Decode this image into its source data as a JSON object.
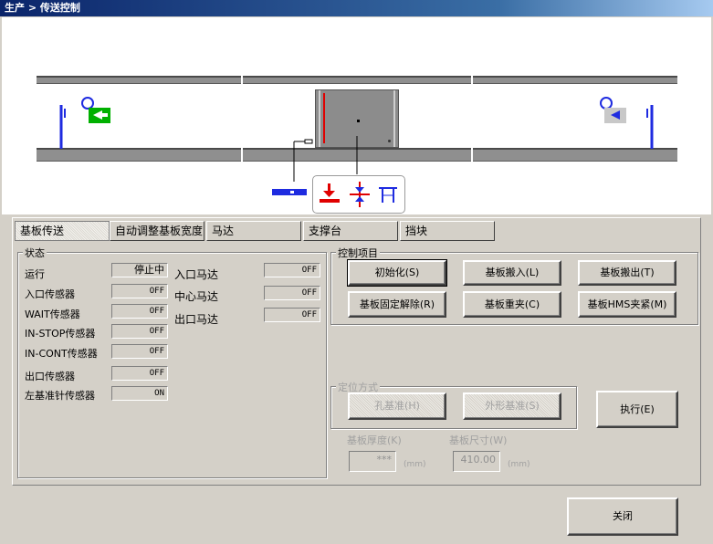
{
  "window": {
    "title": "生产 > 传送控制"
  },
  "tabs": [
    {
      "label": "基板传送"
    },
    {
      "label": "自动调整基板宽度"
    },
    {
      "label": "马达"
    },
    {
      "label": "支撑台"
    },
    {
      "label": "挡块"
    }
  ],
  "status": {
    "title": "状态",
    "rows": [
      {
        "label": "运行",
        "value": "停止中"
      },
      {
        "label": "入口传感器",
        "value": "OFF"
      },
      {
        "label": "WAIT传感器",
        "value": "OFF"
      },
      {
        "label": "IN-STOP传感器",
        "value": "OFF"
      },
      {
        "label": "IN-CONT传感器",
        "value": "OFF"
      },
      {
        "label": "出口传感器",
        "value": "OFF"
      },
      {
        "label": "左基准针传感器",
        "value": "ON"
      }
    ],
    "motors": [
      {
        "label": "入口马达",
        "value": "OFF"
      },
      {
        "label": "中心马达",
        "value": "OFF"
      },
      {
        "label": "出口马达",
        "value": "OFF"
      }
    ]
  },
  "control": {
    "title": "控制项目",
    "buttons": [
      {
        "label": "初始化(S)"
      },
      {
        "label": "基板搬入(L)"
      },
      {
        "label": "基板搬出(T)"
      },
      {
        "label": "基板固定解除(R)"
      },
      {
        "label": "基板重夹(C)"
      },
      {
        "label": "基板HMS夹紧(M)"
      }
    ]
  },
  "positioning": {
    "title": "定位方式",
    "hole_label": "孔基准(H)",
    "outline_label": "外形基准(S)",
    "execute_label": "执行(E)",
    "thickness_label": "基板厚度(K)",
    "thickness_value": "***",
    "thickness_unit": "(mm)",
    "size_label": "基板尺寸(W)",
    "size_value": "410.00",
    "size_unit": "(mm)"
  },
  "close_label": "关闭",
  "colors": {
    "sensor": "#1e2be0",
    "arrow": "#00a000",
    "alert": "#e00000",
    "title_bg": "#0a246a"
  }
}
